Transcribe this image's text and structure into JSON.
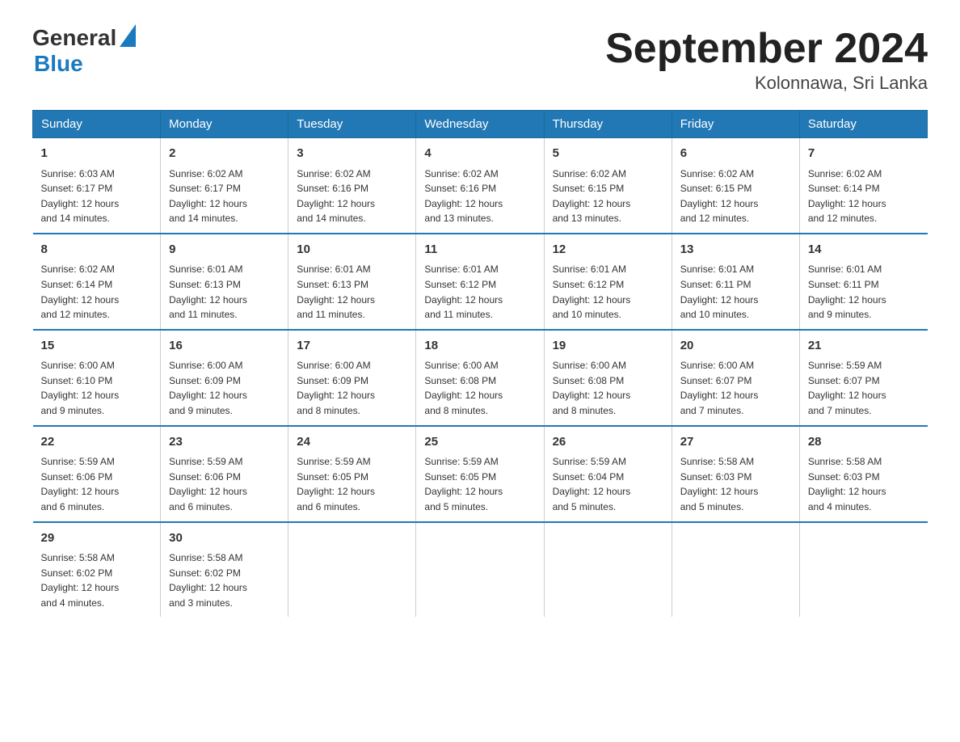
{
  "header": {
    "logo_general": "General",
    "logo_blue": "Blue",
    "month_title": "September 2024",
    "location": "Kolonnawa, Sri Lanka"
  },
  "days_of_week": [
    "Sunday",
    "Monday",
    "Tuesday",
    "Wednesday",
    "Thursday",
    "Friday",
    "Saturday"
  ],
  "weeks": [
    [
      {
        "num": "1",
        "sunrise": "6:03 AM",
        "sunset": "6:17 PM",
        "daylight": "12 hours and 14 minutes."
      },
      {
        "num": "2",
        "sunrise": "6:02 AM",
        "sunset": "6:17 PM",
        "daylight": "12 hours and 14 minutes."
      },
      {
        "num": "3",
        "sunrise": "6:02 AM",
        "sunset": "6:16 PM",
        "daylight": "12 hours and 14 minutes."
      },
      {
        "num": "4",
        "sunrise": "6:02 AM",
        "sunset": "6:16 PM",
        "daylight": "12 hours and 13 minutes."
      },
      {
        "num": "5",
        "sunrise": "6:02 AM",
        "sunset": "6:15 PM",
        "daylight": "12 hours and 13 minutes."
      },
      {
        "num": "6",
        "sunrise": "6:02 AM",
        "sunset": "6:15 PM",
        "daylight": "12 hours and 12 minutes."
      },
      {
        "num": "7",
        "sunrise": "6:02 AM",
        "sunset": "6:14 PM",
        "daylight": "12 hours and 12 minutes."
      }
    ],
    [
      {
        "num": "8",
        "sunrise": "6:02 AM",
        "sunset": "6:14 PM",
        "daylight": "12 hours and 12 minutes."
      },
      {
        "num": "9",
        "sunrise": "6:01 AM",
        "sunset": "6:13 PM",
        "daylight": "12 hours and 11 minutes."
      },
      {
        "num": "10",
        "sunrise": "6:01 AM",
        "sunset": "6:13 PM",
        "daylight": "12 hours and 11 minutes."
      },
      {
        "num": "11",
        "sunrise": "6:01 AM",
        "sunset": "6:12 PM",
        "daylight": "12 hours and 11 minutes."
      },
      {
        "num": "12",
        "sunrise": "6:01 AM",
        "sunset": "6:12 PM",
        "daylight": "12 hours and 10 minutes."
      },
      {
        "num": "13",
        "sunrise": "6:01 AM",
        "sunset": "6:11 PM",
        "daylight": "12 hours and 10 minutes."
      },
      {
        "num": "14",
        "sunrise": "6:01 AM",
        "sunset": "6:11 PM",
        "daylight": "12 hours and 9 minutes."
      }
    ],
    [
      {
        "num": "15",
        "sunrise": "6:00 AM",
        "sunset": "6:10 PM",
        "daylight": "12 hours and 9 minutes."
      },
      {
        "num": "16",
        "sunrise": "6:00 AM",
        "sunset": "6:09 PM",
        "daylight": "12 hours and 9 minutes."
      },
      {
        "num": "17",
        "sunrise": "6:00 AM",
        "sunset": "6:09 PM",
        "daylight": "12 hours and 8 minutes."
      },
      {
        "num": "18",
        "sunrise": "6:00 AM",
        "sunset": "6:08 PM",
        "daylight": "12 hours and 8 minutes."
      },
      {
        "num": "19",
        "sunrise": "6:00 AM",
        "sunset": "6:08 PM",
        "daylight": "12 hours and 8 minutes."
      },
      {
        "num": "20",
        "sunrise": "6:00 AM",
        "sunset": "6:07 PM",
        "daylight": "12 hours and 7 minutes."
      },
      {
        "num": "21",
        "sunrise": "5:59 AM",
        "sunset": "6:07 PM",
        "daylight": "12 hours and 7 minutes."
      }
    ],
    [
      {
        "num": "22",
        "sunrise": "5:59 AM",
        "sunset": "6:06 PM",
        "daylight": "12 hours and 6 minutes."
      },
      {
        "num": "23",
        "sunrise": "5:59 AM",
        "sunset": "6:06 PM",
        "daylight": "12 hours and 6 minutes."
      },
      {
        "num": "24",
        "sunrise": "5:59 AM",
        "sunset": "6:05 PM",
        "daylight": "12 hours and 6 minutes."
      },
      {
        "num": "25",
        "sunrise": "5:59 AM",
        "sunset": "6:05 PM",
        "daylight": "12 hours and 5 minutes."
      },
      {
        "num": "26",
        "sunrise": "5:59 AM",
        "sunset": "6:04 PM",
        "daylight": "12 hours and 5 minutes."
      },
      {
        "num": "27",
        "sunrise": "5:58 AM",
        "sunset": "6:03 PM",
        "daylight": "12 hours and 5 minutes."
      },
      {
        "num": "28",
        "sunrise": "5:58 AM",
        "sunset": "6:03 PM",
        "daylight": "12 hours and 4 minutes."
      }
    ],
    [
      {
        "num": "29",
        "sunrise": "5:58 AM",
        "sunset": "6:02 PM",
        "daylight": "12 hours and 4 minutes."
      },
      {
        "num": "30",
        "sunrise": "5:58 AM",
        "sunset": "6:02 PM",
        "daylight": "12 hours and 3 minutes."
      },
      null,
      null,
      null,
      null,
      null
    ]
  ]
}
